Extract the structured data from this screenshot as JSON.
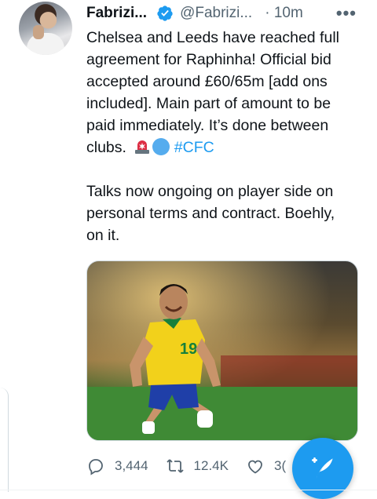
{
  "tweet": {
    "author_name": "Fabrizi...",
    "handle": "@Fabrizi...",
    "time": "· 10m",
    "more_icon": "more-icon",
    "verified_icon": "verified-badge-icon",
    "text": {
      "para1_line1": "Chelsea and Leeds have reached full",
      "para1_line2": "agreement for Raphinha! Official bid",
      "para1_line3": "accepted around £60/65m [add ons",
      "para1_line4": "included]. Main part of amount to be",
      "para1_line5": "paid immediately. It’s done between",
      "para1_line6": "clubs.",
      "hashtag": "#CFC",
      "para2_line1": "Talks now ongoing on player side on",
      "para2_line2": "personal terms and contract. Boehly,",
      "para2_line3": "on it."
    },
    "media": {
      "alt": "football player celebrating",
      "jersey_number": "19"
    },
    "actions": {
      "reply_count": "3,444",
      "retweet_count": "12.4K",
      "like_count": "3("
    }
  },
  "colors": {
    "accent": "#1d9bf0",
    "muted": "#536471",
    "text": "#0f1419"
  },
  "fab": {
    "icon": "compose-tweet-icon"
  }
}
